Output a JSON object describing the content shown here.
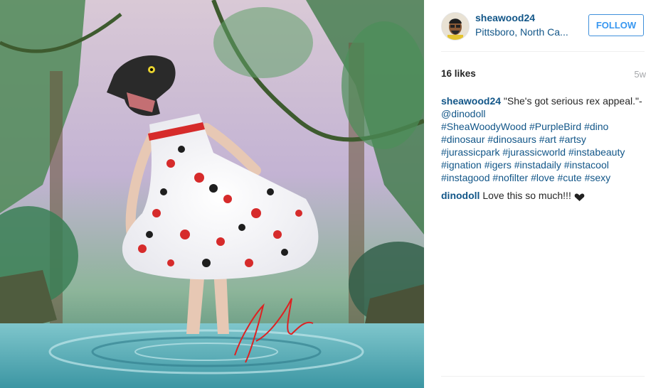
{
  "post": {
    "username": "sheawood24",
    "location": "Pittsboro, North Ca...",
    "follow_label": "FOLLOW",
    "likes": "16 likes",
    "age": "5w",
    "caption": {
      "author": "sheawood24",
      "text": "\"She's got serious rex appeal.\"-",
      "mention": "@dinodoll",
      "hashtags": [
        "#SheaWoodyWood",
        "#PurpleBird",
        "#dino",
        "#dinosaur",
        "#dinosaurs",
        "#art",
        "#artsy",
        "#jurassicpark",
        "#jurassicworld",
        "#instabeauty",
        "#ignation",
        "#igers",
        "#instadaily",
        "#instacool",
        "#instagood",
        "#nofilter",
        "#love",
        "#cute",
        "#sexy"
      ]
    },
    "comments": [
      {
        "author": "dinodoll",
        "text": "Love this so much!!!"
      }
    ]
  },
  "image": {
    "alt": "Illustration of a woman in a floral dress with a T-rex head standing in jungle water",
    "signature": "Shea Wood"
  },
  "colors": {
    "link": "#125688",
    "follow": "#3897f0",
    "text": "#262626",
    "muted": "#a5a7aa"
  }
}
